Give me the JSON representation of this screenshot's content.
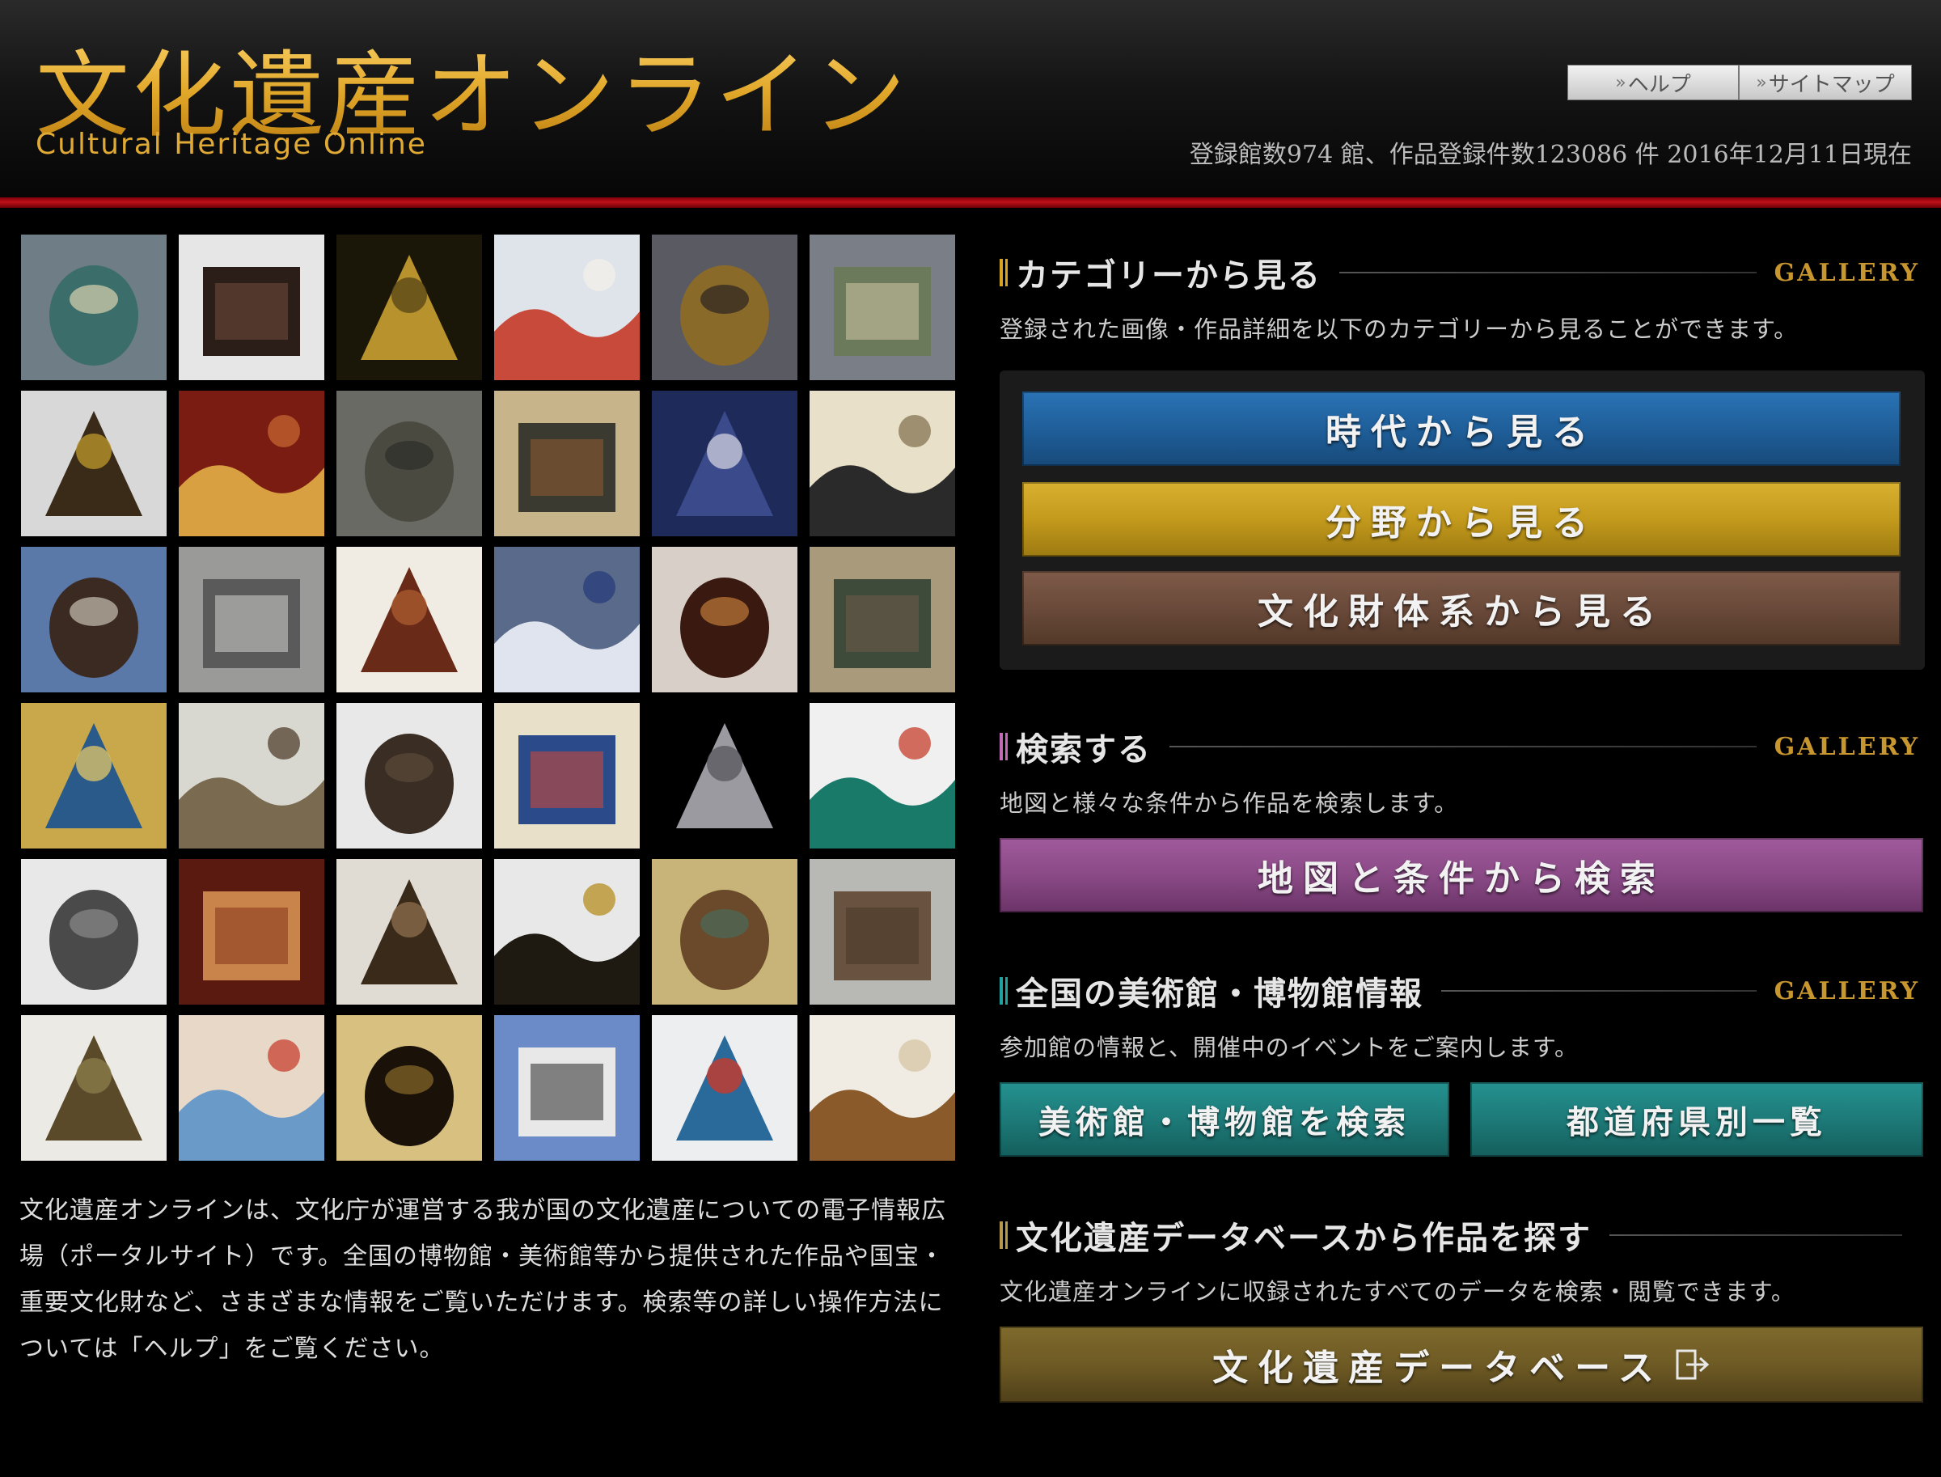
{
  "header": {
    "logo_jp": "文化遺産オンライン",
    "logo_en": "Cultural Heritage Online",
    "help_label": "ヘルプ",
    "sitemap_label": "サイトマップ",
    "stats": "登録館数974 館、作品登録件数123086 件 2016年12月11日現在"
  },
  "gallery": {
    "thumbnails": [
      "celadon-jar",
      "antique-object",
      "buddha-painting",
      "noh-costume-figure",
      "samurai-helmet",
      "bronze-artifact",
      "lacquer-shelf",
      "mandala",
      "demon-mask",
      "screen-painting",
      "indigo-kimono",
      "calligraphy-scroll",
      "farmhouse",
      "ink-landscape",
      "lacquer-boxes",
      "blue-white-jar",
      "lacquer-panel",
      "bird-painting",
      "thunder-god-painting",
      "stoneware-jar",
      "buddha-bust",
      "court-scene-painting",
      "katana-blade",
      "green-ceramic-pot",
      "guardian-statue",
      "shrine-altar",
      "armor",
      "inlaid-chest",
      "world-map-screen",
      "priest-statue",
      "iron-kettle",
      "scroll-painting",
      "sutra-calligraphy",
      "western-building",
      "porcelain-plate",
      "white-kimono"
    ]
  },
  "intro": "文化遺産オンラインは、文化庁が運営する我が国の文化遺産についての電子情報広場（ポータルサイト）です。全国の博物館・美術館等から提供された作品や国宝・重要文化財など、さまざまな情報をご覧いただけます。検索等の詳しい操作方法については「ヘルプ」をご覧ください。",
  "sections": {
    "category": {
      "title": "カテゴリーから見る",
      "gallery": "GALLERY",
      "desc": "登録された画像・作品詳細を以下のカテゴリーから見ることができます。",
      "buttons": [
        "時代から見る",
        "分野から見る",
        "文化財体系から見る"
      ]
    },
    "search": {
      "title": "検索する",
      "gallery": "GALLERY",
      "desc": "地図と様々な条件から作品を検索します。",
      "button": "地図と条件から検索"
    },
    "museums": {
      "title": "全国の美術館・博物館情報",
      "gallery": "GALLERY",
      "desc": "参加館の情報と、開催中のイベントをご案内します。",
      "buttons": [
        "美術館・博物館を検索",
        "都道府県別一覧"
      ]
    },
    "database": {
      "title": "文化遺産データベースから作品を探す",
      "desc": "文化遺産オンラインに収録されたすべてのデータを検索・閲覧できます。",
      "button": "文化遺産データベース"
    }
  },
  "colors": {
    "logo_gold": "#e8b53a",
    "header_red": "#c0101a",
    "btn_era": "#1f5f9a",
    "btn_field": "#c39a1c",
    "btn_system": "#6a4a3a",
    "btn_search": "#8a4a86",
    "btn_museum": "#1d7a78",
    "btn_database": "#6e5a24"
  }
}
